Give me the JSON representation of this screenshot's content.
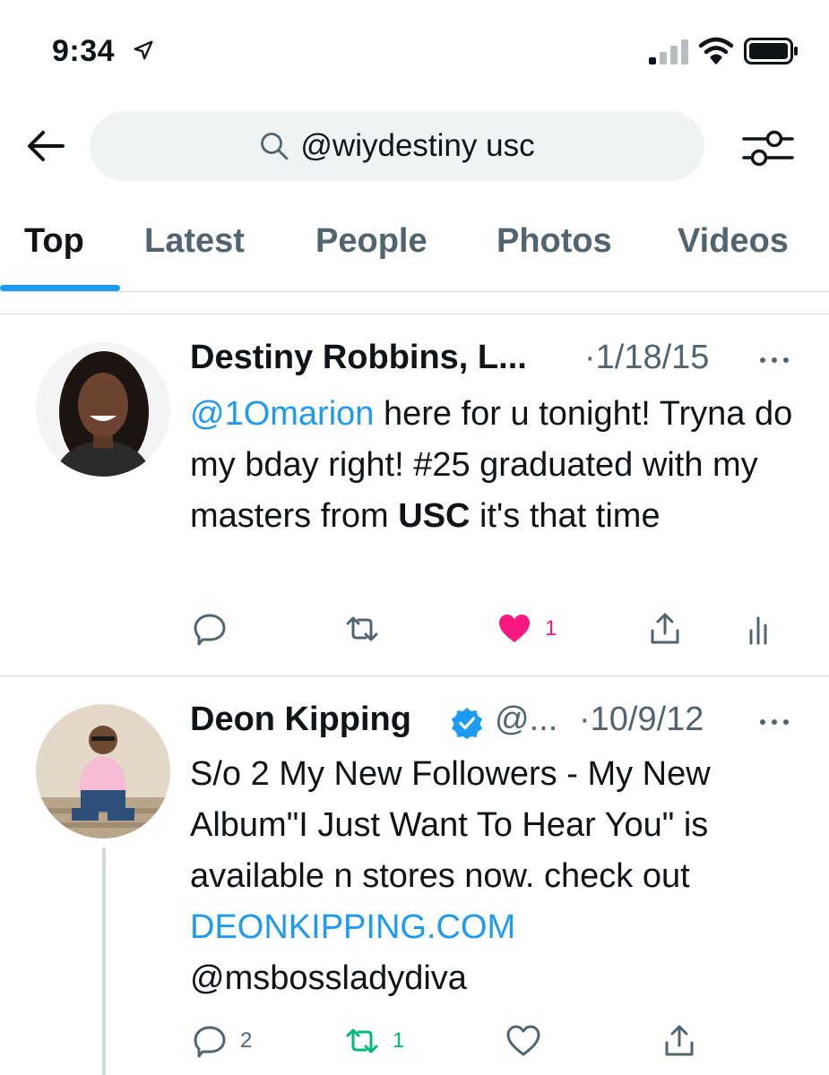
{
  "status_bar": {
    "time": "9:34"
  },
  "search": {
    "query": "@wiydestiny usc"
  },
  "tabs": [
    {
      "label": "Top",
      "active": true
    },
    {
      "label": "Latest",
      "active": false
    },
    {
      "label": "People",
      "active": false
    },
    {
      "label": "Photos",
      "active": false
    },
    {
      "label": "Videos",
      "active": false
    }
  ],
  "tweets": [
    {
      "author": "Destiny Robbins, L...",
      "handle": "",
      "date": "·1/18/15",
      "text_mention": "@1Omarion",
      "text_1": " here for u tonight! Tryna do my bday right! #25 graduated with my masters from ",
      "text_bold": "USC",
      "text_2": " it's that time",
      "replies": "",
      "retweets": "",
      "likes": "1",
      "liked": true
    },
    {
      "author": "Deon Kipping",
      "verified": true,
      "handle": "@...",
      "date": "·10/9/12",
      "text_1": "S/o 2 My New Followers - My New Album\"I Just Want To Hear You\" is available n stores now. check out ",
      "text_link": "DEONKIPPING.COM",
      "text_2": "@msbossladydiva",
      "replies": "2",
      "retweets": "1",
      "likes": "",
      "liked": false
    }
  ],
  "colors": {
    "accent": "#1d9bf0",
    "like": "#f91880",
    "retweet_active": "#00ba7c",
    "secondary": "#536471"
  }
}
